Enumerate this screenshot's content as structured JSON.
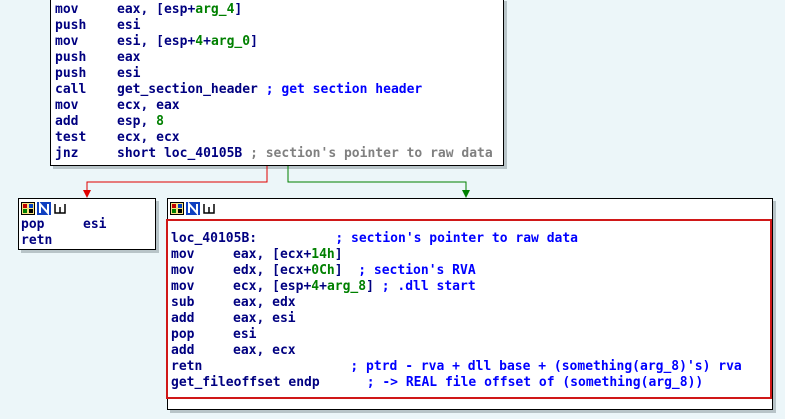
{
  "top_node": {
    "lines": [
      {
        "ins": "mov",
        "ops": [
          {
            "t": "eax, [esp+"
          },
          {
            "t": "arg_4",
            "c": "num"
          },
          {
            "t": "]"
          }
        ]
      },
      {
        "ins": "push",
        "ops": [
          {
            "t": "esi"
          }
        ]
      },
      {
        "ins": "mov",
        "ops": [
          {
            "t": "esi, [esp+"
          },
          {
            "t": "4",
            "c": "num"
          },
          {
            "t": "+"
          },
          {
            "t": "arg_0",
            "c": "num"
          },
          {
            "t": "]"
          }
        ]
      },
      {
        "ins": "push",
        "ops": [
          {
            "t": "eax"
          }
        ]
      },
      {
        "ins": "push",
        "ops": [
          {
            "t": "esi"
          }
        ]
      },
      {
        "ins": "call",
        "ops": [
          {
            "t": "get_section_header ",
            "c": "lbl"
          },
          {
            "t": "; get section header",
            "c": "cmt"
          }
        ]
      },
      {
        "ins": "mov",
        "ops": [
          {
            "t": "ecx, eax"
          }
        ]
      },
      {
        "ins": "add",
        "ops": [
          {
            "t": "esp, "
          },
          {
            "t": "8",
            "c": "num"
          }
        ]
      },
      {
        "ins": "test",
        "ops": [
          {
            "t": "ecx, ecx"
          }
        ]
      },
      {
        "ins": "jnz",
        "ops": [
          {
            "t": "short loc_40105B "
          },
          {
            "t": "; section's pointer to raw data",
            "c": "gcmt"
          }
        ]
      }
    ]
  },
  "left_node": {
    "lines": [
      {
        "ins": "pop",
        "ops": [
          {
            "t": "esi"
          }
        ]
      },
      {
        "ins": "retn",
        "ops": []
      }
    ]
  },
  "right_node": {
    "lines": [
      {
        "label": "loc_40105B:",
        "ops": [
          {
            "t": "          "
          },
          {
            "t": "; section's pointer to raw data",
            "c": "cmt"
          }
        ]
      },
      {
        "ins": "mov",
        "ops": [
          {
            "t": "eax, [ecx+"
          },
          {
            "t": "14h",
            "c": "num"
          },
          {
            "t": "]"
          }
        ]
      },
      {
        "ins": "mov",
        "ops": [
          {
            "t": "edx, [ecx+"
          },
          {
            "t": "0Ch",
            "c": "num"
          },
          {
            "t": "]  "
          },
          {
            "t": "; section's RVA",
            "c": "cmt"
          }
        ]
      },
      {
        "ins": "mov",
        "ops": [
          {
            "t": "ecx, [esp+"
          },
          {
            "t": "4",
            "c": "num"
          },
          {
            "t": "+"
          },
          {
            "t": "arg_8",
            "c": "num"
          },
          {
            "t": "] "
          },
          {
            "t": "; .dll start",
            "c": "cmt"
          }
        ]
      },
      {
        "ins": "sub",
        "ops": [
          {
            "t": "eax, edx"
          }
        ]
      },
      {
        "ins": "add",
        "ops": [
          {
            "t": "eax, esi"
          }
        ]
      },
      {
        "ins": "pop",
        "ops": [
          {
            "t": "esi"
          }
        ]
      },
      {
        "ins": "add",
        "ops": [
          {
            "t": "eax, ecx"
          }
        ]
      },
      {
        "ins": "retn",
        "ops": [
          {
            "t": "               "
          },
          {
            "t": "; ptrd - rva + dll base + (something(arg_8)'s) rva",
            "c": "cmt"
          }
        ]
      },
      {
        "label": "get_fileoffset endp",
        "ops": [
          {
            "t": "      "
          },
          {
            "t": "; -> REAL file offset of (something(arg_8))",
            "c": "cmt"
          }
        ]
      }
    ]
  },
  "colors": {
    "false_edge": "#e00000",
    "true_edge": "#008000",
    "highlight": "#d01818"
  }
}
